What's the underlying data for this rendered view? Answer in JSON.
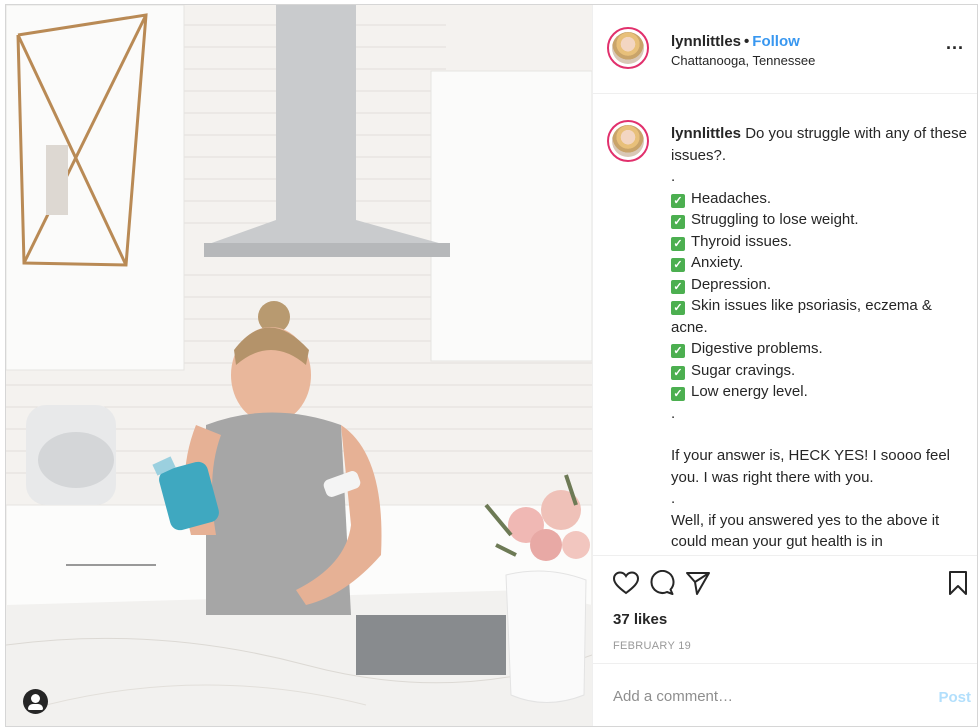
{
  "post": {
    "username": "lynnlittles",
    "follow_label": "Follow",
    "separator": "•",
    "location": "Chattanooga, Tennessee",
    "more_label": "..."
  },
  "caption": {
    "username": "lynnlittles",
    "intro": "Do you struggle with any of these issues?.",
    "dot1": ".",
    "checkmark_glyph": "✓",
    "items": [
      "Headaches.",
      "Struggling to lose weight.",
      "Thyroid issues.",
      "Anxiety.",
      "Depression.",
      "Skin issues like psoriasis, eczema & acne.",
      "Digestive problems.",
      "Sugar cravings.",
      "Low energy level."
    ],
    "dot2": ".",
    "para1": "If your answer is, HECK YES! I soooo feel you. I was right there with you.",
    "dot3": ".",
    "para2": "Well, if you answered yes to the above it could mean your gut health is in"
  },
  "stats": {
    "likes": "37 likes",
    "date": "FEBRUARY 19"
  },
  "comment": {
    "placeholder": "Add a comment…",
    "post_label": "Post"
  },
  "colors": {
    "follow": "#3897f0",
    "avatar_ring": "#e1306c",
    "check_green": "#4caf50",
    "post_disabled": "#b2dffc"
  },
  "icons": [
    "heart-icon",
    "comment-icon",
    "share-icon",
    "bookmark-icon",
    "user-tag-icon",
    "more-options-icon"
  ]
}
